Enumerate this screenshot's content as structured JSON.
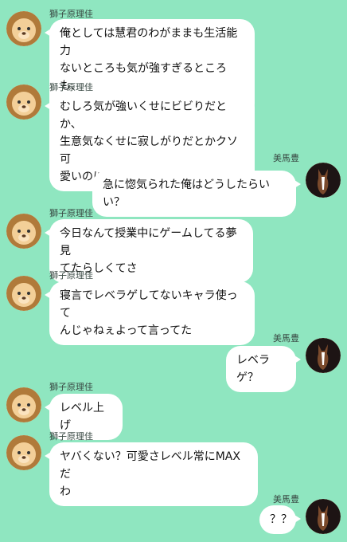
{
  "colors": {
    "background": "#8fe6c0",
    "bubble": "#ffffff"
  },
  "participants": {
    "left": {
      "name": "獅子原理佳",
      "avatar": "lion-cub-icon"
    },
    "right": {
      "name": "美馬豊",
      "avatar": "horse-icon"
    }
  },
  "messages": [
    {
      "side": "left",
      "text": "俺としては慧君のわがままも生活能力\nないところも気が強すぎるところも、\nどタイプなのに"
    },
    {
      "side": "left",
      "text": "むしろ気が強いくせにビビりだとか、\n生意気なくせに寂しがりだとかクソ可\n愛いのにな"
    },
    {
      "side": "right",
      "text": "急に惚気られた俺はどうしたらいい？"
    },
    {
      "side": "left",
      "text": "今日なんて授業中にゲームしてる夢見\nてたらしくてさ"
    },
    {
      "side": "left",
      "text": "寝言でレベラゲしてないキャラ使って\nんじゃねぇよって言ってた"
    },
    {
      "side": "right",
      "text": "レベラゲ？"
    },
    {
      "side": "left",
      "text": "レベル上げ"
    },
    {
      "side": "left",
      "text": "ヤバくない？可愛さレベル常にMAXだ\nわ"
    },
    {
      "side": "right",
      "text": "？？"
    }
  ]
}
